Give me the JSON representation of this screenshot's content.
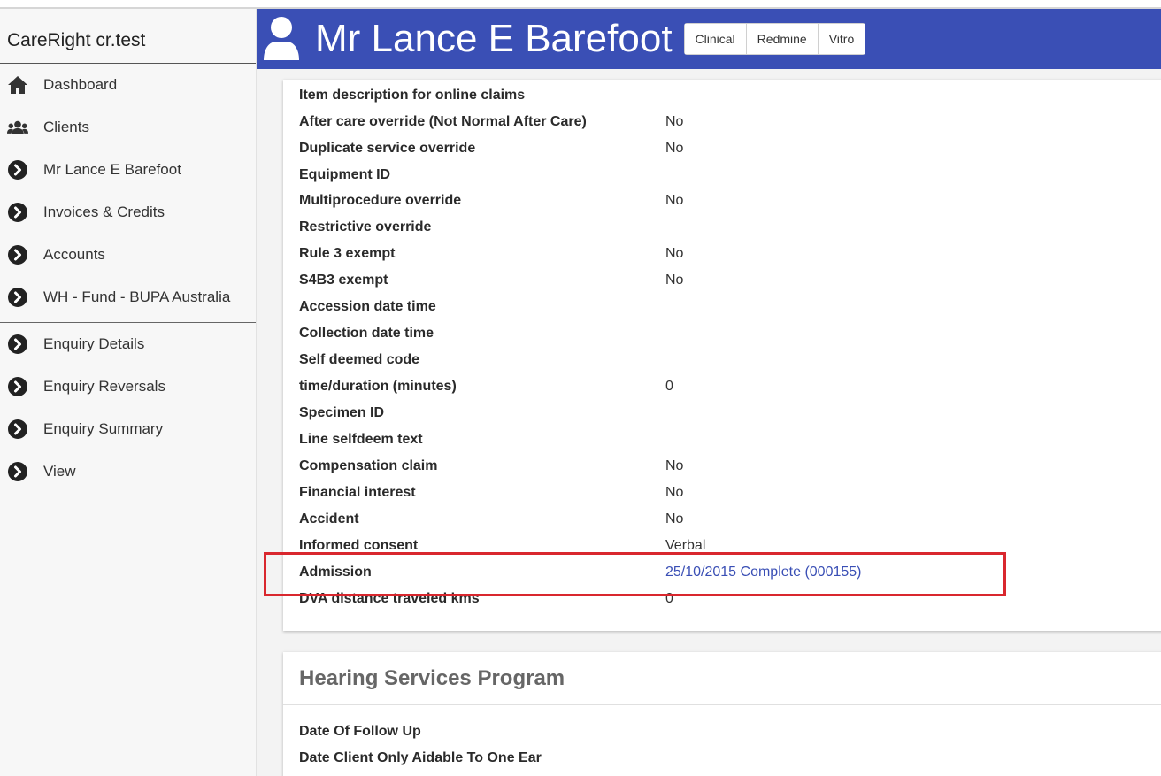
{
  "app": {
    "brand": "CareRight cr.test"
  },
  "sidebar": {
    "items": [
      {
        "label": "Dashboard",
        "icon": "home-icon"
      },
      {
        "label": "Clients",
        "icon": "users-icon"
      },
      {
        "label": "Mr Lance E Barefoot",
        "icon": "chevron-circle-icon"
      },
      {
        "label": "Invoices & Credits",
        "icon": "chevron-circle-icon"
      },
      {
        "label": "Accounts",
        "icon": "chevron-circle-icon"
      },
      {
        "label": "WH - Fund - BUPA Australia",
        "icon": "chevron-circle-icon"
      }
    ],
    "items2": [
      {
        "label": "Enquiry Details",
        "icon": "chevron-circle-icon"
      },
      {
        "label": "Enquiry Reversals",
        "icon": "chevron-circle-icon"
      },
      {
        "label": "Enquiry Summary",
        "icon": "chevron-circle-icon"
      },
      {
        "label": "View",
        "icon": "chevron-circle-icon"
      }
    ]
  },
  "header": {
    "name": "Mr Lance E Barefoot",
    "buttons": [
      "Clinical",
      "Redmine",
      "Vitro"
    ],
    "color": "#3a4fb5"
  },
  "details": {
    "rows": [
      {
        "label": "Item description for online claims",
        "value": ""
      },
      {
        "label": "After care override (Not Normal After Care)",
        "value": "No"
      },
      {
        "label": "Duplicate service override",
        "value": "No"
      },
      {
        "label": "Equipment ID",
        "value": ""
      },
      {
        "label": "Multiprocedure override",
        "value": "No"
      },
      {
        "label": "Restrictive override",
        "value": ""
      },
      {
        "label": "Rule 3 exempt",
        "value": "No"
      },
      {
        "label": "S4B3 exempt",
        "value": "No"
      },
      {
        "label": "Accession date time",
        "value": ""
      },
      {
        "label": "Collection date time",
        "value": ""
      },
      {
        "label": "Self deemed code",
        "value": ""
      },
      {
        "label": "time/duration (minutes)",
        "value": "0"
      },
      {
        "label": "Specimen ID",
        "value": ""
      },
      {
        "label": "Line selfdeem text",
        "value": ""
      },
      {
        "label": "Compensation claim",
        "value": "No"
      },
      {
        "label": "Financial interest",
        "value": "No"
      },
      {
        "label": "Accident",
        "value": "No"
      },
      {
        "label": "Informed consent",
        "value": "Verbal"
      },
      {
        "label": "Admission",
        "value": "25/10/2015 Complete (000155)",
        "link": true
      },
      {
        "label": "DVA distance traveled kms",
        "value": "0"
      }
    ]
  },
  "hearing": {
    "title": "Hearing Services Program",
    "rows": [
      {
        "label": "Date Of Follow Up",
        "value": ""
      },
      {
        "label": "Date Client Only Aidable To One Ear",
        "value": ""
      }
    ]
  },
  "highlight_color": "#d9272e"
}
